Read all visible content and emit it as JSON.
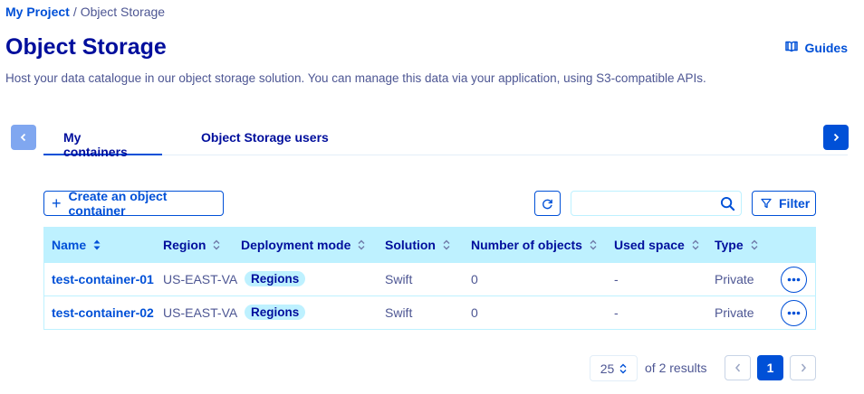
{
  "breadcrumb": {
    "project": "My Project",
    "separator": "/",
    "current": "Object Storage"
  },
  "header": {
    "title": "Object Storage",
    "guides_label": "Guides",
    "subtitle": "Host your data catalogue in our object storage solution. You can manage this data via your application, using S3-compatible APIs."
  },
  "tabs": [
    {
      "label": "My containers",
      "active": true
    },
    {
      "label": "Object Storage users",
      "active": false
    }
  ],
  "toolbar": {
    "create_label": "Create an object container",
    "search_value": "",
    "filter_label": "Filter"
  },
  "table": {
    "columns": [
      "Name",
      "Region",
      "Deployment mode",
      "Solution",
      "Number of objects",
      "Used space",
      "Type"
    ],
    "rows": [
      {
        "name": "test-container-01",
        "region": "US-EAST-VA",
        "deployment": "Regions",
        "solution": "Swift",
        "objects": "0",
        "used_space": "-",
        "type": "Private"
      },
      {
        "name": "test-container-02",
        "region": "US-EAST-VA",
        "deployment": "Regions",
        "solution": "Swift",
        "objects": "0",
        "used_space": "-",
        "type": "Private"
      }
    ]
  },
  "pagination": {
    "page_size": "25",
    "results_text": "of 2 results",
    "current_page": "1"
  },
  "colors": {
    "primary": "#0050d7",
    "title": "#000e9c",
    "text": "#4d5693",
    "header_bg": "#bef1ff"
  },
  "icons": {
    "guides": "book-icon",
    "refresh": "refresh-icon",
    "search": "search-icon",
    "filter": "filter-icon",
    "more": "more-icon"
  }
}
